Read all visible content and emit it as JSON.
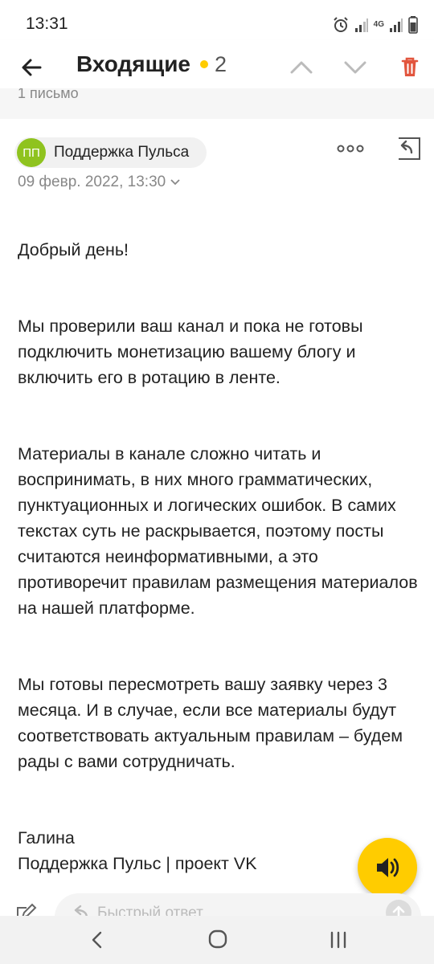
{
  "status_bar": {
    "time": "13:31",
    "network": "4G"
  },
  "header": {
    "title": "Входящие",
    "unread_count": "2",
    "unread_color": "#ffcc00"
  },
  "letters_strip": {
    "text": "1 письмо"
  },
  "message": {
    "sender_initials": "ПП",
    "sender_name": "Поддержка Пульса",
    "avatar_color": "#8fc31f",
    "date": "09 февр. 2022, 13:30",
    "greeting": "Добрый день!",
    "paragraphs": [
      "Мы проверили ваш канал и пока не готовы подключить монетизацию вашему блогу и включить его в ротацию в ленте.",
      "Материалы в канале сложно читать и воспринимать, в них много грамматических, пунктуационных и логических ошибок. В самих текстах суть не раскрывается, поэтому посты считаются неинформативными, а это противоречит правилам размещения материалов на нашей платформе.",
      "Мы готовы пересмотреть вашу заявку через 3 месяца. И в случае, если все материалы будут соответствовать актуальным правилам – будем рады с вами сотрудничать."
    ],
    "signature_name": "Галина",
    "signature_org": "Поддержка Пульс | проект VK"
  },
  "quick_reply": {
    "placeholder": "Быстрый ответ"
  },
  "icons": {
    "back": "arrow-left-icon",
    "up": "chevron-up-icon",
    "down": "chevron-down-icon",
    "trash": "trash-icon",
    "more": "more-dots-icon",
    "reply": "reply-icon",
    "audio": "speaker-icon",
    "compose": "pencil-icon"
  },
  "colors": {
    "accent": "#ffcc00",
    "trash": "#e2553d"
  }
}
